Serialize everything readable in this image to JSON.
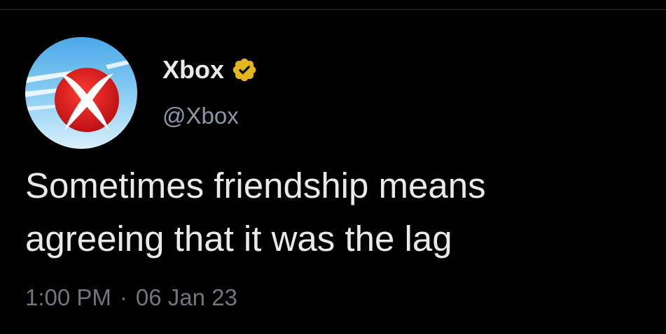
{
  "tweet": {
    "author": {
      "display_name": "Xbox",
      "handle": "@Xbox",
      "verified": true,
      "verified_badge_icon": "verified-badge-icon",
      "verified_badge_color": "#e2b719",
      "avatar_icon": "xbox-logo-avatar-icon"
    },
    "text_lines": [
      "Sometimes friendship means",
      "agreeing that it was the lag"
    ],
    "time": "1:00 PM",
    "separator": "·",
    "date": "06 Jan 23"
  },
  "colors": {
    "background": "#000000",
    "primary_text": "#e7e9ea",
    "secondary_text": "#71767b",
    "handle_text": "#8b98a5",
    "xbox_red": "#d81f1f",
    "avatar_sky": "#7ec6ef"
  }
}
